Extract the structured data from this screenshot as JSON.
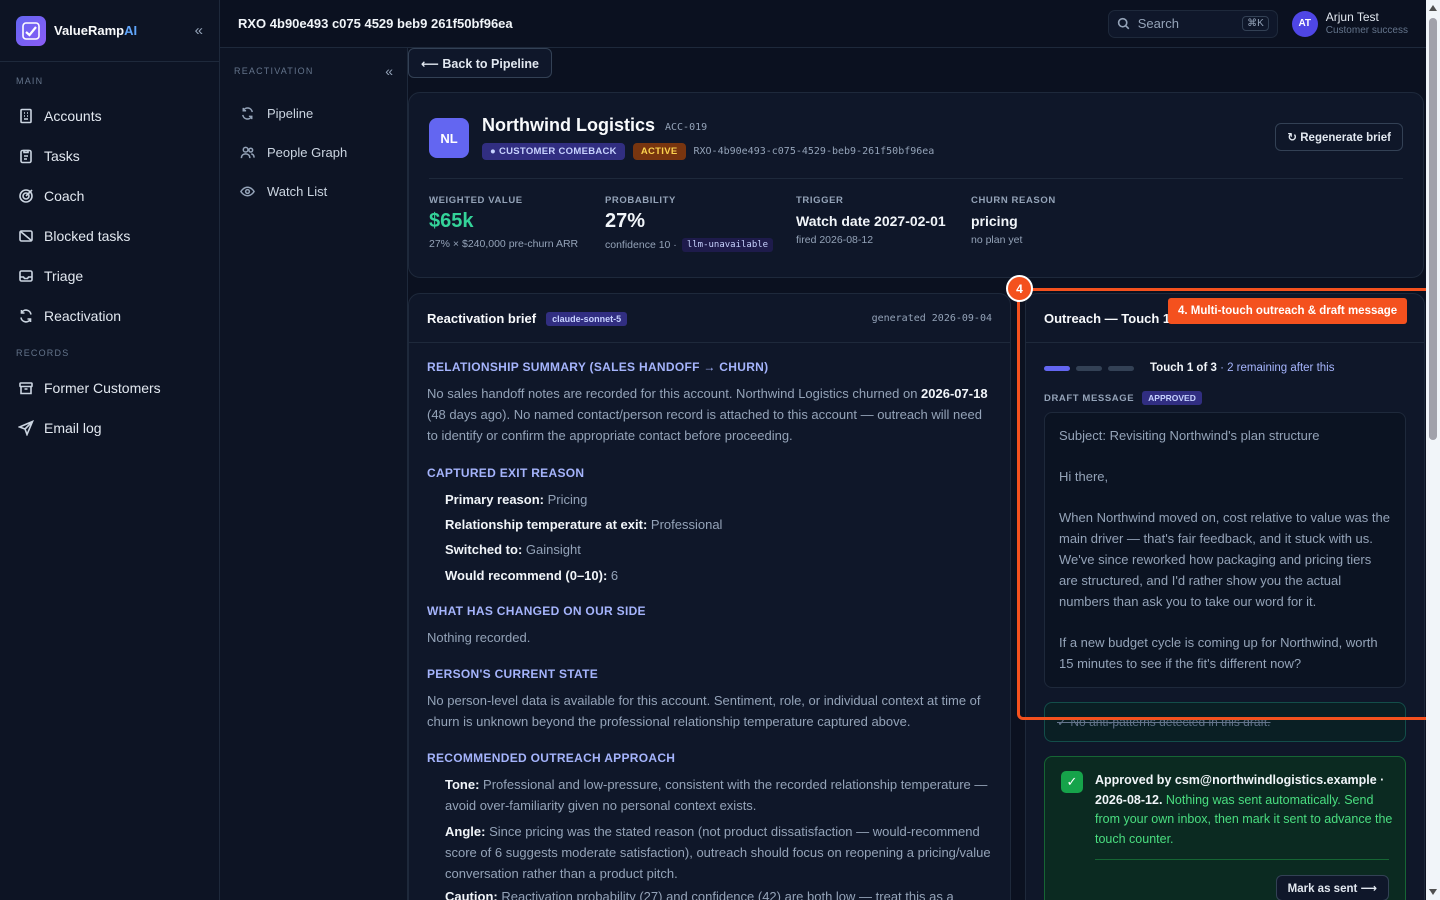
{
  "brand": {
    "name": "ValueRamp",
    "suffix": "AI"
  },
  "sidebar": {
    "main_label": "MAIN",
    "main_items": [
      {
        "label": "Accounts",
        "icon": "building-icon"
      },
      {
        "label": "Tasks",
        "icon": "clipboard-icon"
      },
      {
        "label": "Coach",
        "icon": "target-icon"
      },
      {
        "label": "Blocked tasks",
        "icon": "blocked-icon"
      },
      {
        "label": "Triage",
        "icon": "inbox-icon"
      },
      {
        "label": "Reactivation",
        "icon": "refresh-icon"
      }
    ],
    "records_label": "RECORDS",
    "records_items": [
      {
        "label": "Former Customers",
        "icon": "archive-icon"
      },
      {
        "label": "Email log",
        "icon": "send-icon"
      }
    ]
  },
  "subsidebar": {
    "label": "REACTIVATION",
    "items": [
      {
        "label": "Pipeline",
        "icon": "refresh-icon"
      },
      {
        "label": "People Graph",
        "icon": "people-icon"
      },
      {
        "label": "Watch List",
        "icon": "eye-icon"
      }
    ]
  },
  "topbar": {
    "title": "RXO 4b90e493 c075 4529 beb9 261f50bf96ea",
    "search_placeholder": "Search",
    "search_shortcut": "⌘K",
    "user_initials": "AT",
    "user_name": "Arjun Test",
    "user_role": "Customer success"
  },
  "back_label": "⟵ Back to Pipeline",
  "account": {
    "initials": "NL",
    "name": "Northwind Logistics",
    "id": "ACC-019",
    "badge_type": "● CUSTOMER COMEBACK",
    "badge_status": "ACTIVE",
    "rxo_id": "RXO-4b90e493-c075-4529-beb9-261f50bf96ea",
    "regenerate_label": "↻ Regenerate brief",
    "metrics": [
      {
        "label": "WEIGHTED VALUE",
        "value": "$65k",
        "sub": "27% × $240,000 pre-churn ARR"
      },
      {
        "label": "PROBABILITY",
        "value": "27%",
        "sub": "confidence 10 ·",
        "tag": "llm-unavailable"
      },
      {
        "label": "TRIGGER",
        "value": "Watch date 2027-02-01",
        "sub": "fired 2026-08-12"
      },
      {
        "label": "CHURN REASON",
        "value": "pricing",
        "sub": "no plan yet"
      }
    ]
  },
  "brief": {
    "title": "Reactivation brief",
    "model": "claude-sonnet-5",
    "generated": "generated 2026-09-04",
    "s1_title": "RELATIONSHIP SUMMARY (SALES HANDOFF → CHURN)",
    "s1_a": "No sales handoff notes are recorded for this account. Northwind Logistics churned on ",
    "s1_date": "2026-07-18",
    "s1_b": " (48 days ago). No named contact/person record is attached to this account — outreach will need to identify or confirm the appropriate contact before proceeding.",
    "s2_title": "CAPTURED EXIT REASON",
    "s2_items": [
      {
        "k": "Primary reason:",
        "v": " Pricing"
      },
      {
        "k": "Relationship temperature at exit:",
        "v": " Professional"
      },
      {
        "k": "Switched to:",
        "v": " Gainsight"
      },
      {
        "k": "Would recommend (0–10):",
        "v": " 6"
      }
    ],
    "s3_title": "WHAT HAS CHANGED ON OUR SIDE",
    "s3_text": "Nothing recorded.",
    "s4_title": "PERSON'S CURRENT STATE",
    "s4_text": "No person-level data is available for this account. Sentiment, role, or individual context at time of churn is unknown beyond the professional relationship temperature captured above.",
    "s5_title": "RECOMMENDED OUTREACH APPROACH",
    "s5_items": [
      {
        "k": "Tone:",
        "v": " Professional and low-pressure, consistent with the recorded relationship temperature — avoid over-familiarity given no personal context exists."
      },
      {
        "k": "Angle:",
        "v": " Since pricing was the stated reason (not product dissatisfaction — would-recommend score of 6 suggests moderate satisfaction), outreach should focus on reopening a pricing/value conversation rather than a product pitch."
      },
      {
        "k": "Caution:",
        "v": " Reactivation probability (27) and confidence (42) are both low — treat this as a"
      }
    ]
  },
  "outreach": {
    "title": "Outreach — Touch 1",
    "touch_text": "Touch 1 of 3",
    "touch_remaining": " · 2 remaining after this",
    "touches_done": 1,
    "touches_total": 3,
    "draft_label": "DRAFT MESSAGE",
    "draft_badge": "APPROVED",
    "draft_subject": "Subject: Revisiting Northwind's plan structure",
    "draft_greeting": "Hi there,",
    "draft_p1": "When Northwind moved on, cost relative to value was the main driver — that's fair feedback, and it stuck with us. We've since reworked how packaging and pricing tiers are structured, and I'd rather show you the actual numbers than ask you to take our word for it.",
    "draft_p2": "If a new budget cycle is coming up for Northwind, worth 15 minutes to see if the fit's different now?",
    "anti_text": "✓ No anti-patterns detected in this draft.",
    "approved_by": "Approved by csm@northwindlogistics.example · 2026-08-12.",
    "approved_note": " Nothing was sent automatically. Send from your own inbox, then mark it sent to advance the touch counter.",
    "mark_sent": "Mark as sent ⟶"
  },
  "annotation": {
    "number": "4",
    "label": "4. Multi-touch outreach & draft message",
    "color": "#f4511e"
  }
}
